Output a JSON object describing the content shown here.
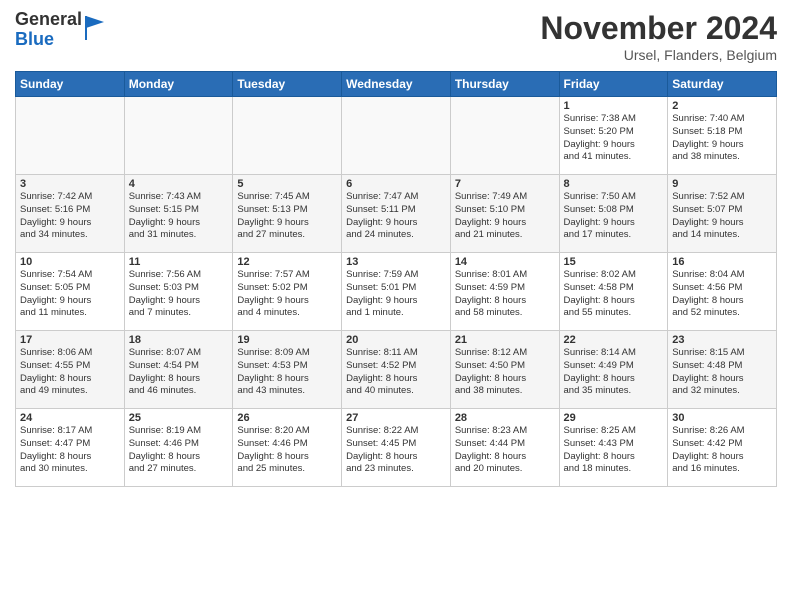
{
  "logo": {
    "general": "General",
    "blue": "Blue"
  },
  "title": "November 2024",
  "location": "Ursel, Flanders, Belgium",
  "headers": [
    "Sunday",
    "Monday",
    "Tuesday",
    "Wednesday",
    "Thursday",
    "Friday",
    "Saturday"
  ],
  "weeks": [
    [
      {
        "day": "",
        "info": ""
      },
      {
        "day": "",
        "info": ""
      },
      {
        "day": "",
        "info": ""
      },
      {
        "day": "",
        "info": ""
      },
      {
        "day": "",
        "info": ""
      },
      {
        "day": "1",
        "info": "Sunrise: 7:38 AM\nSunset: 5:20 PM\nDaylight: 9 hours\nand 41 minutes."
      },
      {
        "day": "2",
        "info": "Sunrise: 7:40 AM\nSunset: 5:18 PM\nDaylight: 9 hours\nand 38 minutes."
      }
    ],
    [
      {
        "day": "3",
        "info": "Sunrise: 7:42 AM\nSunset: 5:16 PM\nDaylight: 9 hours\nand 34 minutes."
      },
      {
        "day": "4",
        "info": "Sunrise: 7:43 AM\nSunset: 5:15 PM\nDaylight: 9 hours\nand 31 minutes."
      },
      {
        "day": "5",
        "info": "Sunrise: 7:45 AM\nSunset: 5:13 PM\nDaylight: 9 hours\nand 27 minutes."
      },
      {
        "day": "6",
        "info": "Sunrise: 7:47 AM\nSunset: 5:11 PM\nDaylight: 9 hours\nand 24 minutes."
      },
      {
        "day": "7",
        "info": "Sunrise: 7:49 AM\nSunset: 5:10 PM\nDaylight: 9 hours\nand 21 minutes."
      },
      {
        "day": "8",
        "info": "Sunrise: 7:50 AM\nSunset: 5:08 PM\nDaylight: 9 hours\nand 17 minutes."
      },
      {
        "day": "9",
        "info": "Sunrise: 7:52 AM\nSunset: 5:07 PM\nDaylight: 9 hours\nand 14 minutes."
      }
    ],
    [
      {
        "day": "10",
        "info": "Sunrise: 7:54 AM\nSunset: 5:05 PM\nDaylight: 9 hours\nand 11 minutes."
      },
      {
        "day": "11",
        "info": "Sunrise: 7:56 AM\nSunset: 5:03 PM\nDaylight: 9 hours\nand 7 minutes."
      },
      {
        "day": "12",
        "info": "Sunrise: 7:57 AM\nSunset: 5:02 PM\nDaylight: 9 hours\nand 4 minutes."
      },
      {
        "day": "13",
        "info": "Sunrise: 7:59 AM\nSunset: 5:01 PM\nDaylight: 9 hours\nand 1 minute."
      },
      {
        "day": "14",
        "info": "Sunrise: 8:01 AM\nSunset: 4:59 PM\nDaylight: 8 hours\nand 58 minutes."
      },
      {
        "day": "15",
        "info": "Sunrise: 8:02 AM\nSunset: 4:58 PM\nDaylight: 8 hours\nand 55 minutes."
      },
      {
        "day": "16",
        "info": "Sunrise: 8:04 AM\nSunset: 4:56 PM\nDaylight: 8 hours\nand 52 minutes."
      }
    ],
    [
      {
        "day": "17",
        "info": "Sunrise: 8:06 AM\nSunset: 4:55 PM\nDaylight: 8 hours\nand 49 minutes."
      },
      {
        "day": "18",
        "info": "Sunrise: 8:07 AM\nSunset: 4:54 PM\nDaylight: 8 hours\nand 46 minutes."
      },
      {
        "day": "19",
        "info": "Sunrise: 8:09 AM\nSunset: 4:53 PM\nDaylight: 8 hours\nand 43 minutes."
      },
      {
        "day": "20",
        "info": "Sunrise: 8:11 AM\nSunset: 4:52 PM\nDaylight: 8 hours\nand 40 minutes."
      },
      {
        "day": "21",
        "info": "Sunrise: 8:12 AM\nSunset: 4:50 PM\nDaylight: 8 hours\nand 38 minutes."
      },
      {
        "day": "22",
        "info": "Sunrise: 8:14 AM\nSunset: 4:49 PM\nDaylight: 8 hours\nand 35 minutes."
      },
      {
        "day": "23",
        "info": "Sunrise: 8:15 AM\nSunset: 4:48 PM\nDaylight: 8 hours\nand 32 minutes."
      }
    ],
    [
      {
        "day": "24",
        "info": "Sunrise: 8:17 AM\nSunset: 4:47 PM\nDaylight: 8 hours\nand 30 minutes."
      },
      {
        "day": "25",
        "info": "Sunrise: 8:19 AM\nSunset: 4:46 PM\nDaylight: 8 hours\nand 27 minutes."
      },
      {
        "day": "26",
        "info": "Sunrise: 8:20 AM\nSunset: 4:46 PM\nDaylight: 8 hours\nand 25 minutes."
      },
      {
        "day": "27",
        "info": "Sunrise: 8:22 AM\nSunset: 4:45 PM\nDaylight: 8 hours\nand 23 minutes."
      },
      {
        "day": "28",
        "info": "Sunrise: 8:23 AM\nSunset: 4:44 PM\nDaylight: 8 hours\nand 20 minutes."
      },
      {
        "day": "29",
        "info": "Sunrise: 8:25 AM\nSunset: 4:43 PM\nDaylight: 8 hours\nand 18 minutes."
      },
      {
        "day": "30",
        "info": "Sunrise: 8:26 AM\nSunset: 4:42 PM\nDaylight: 8 hours\nand 16 minutes."
      }
    ]
  ]
}
